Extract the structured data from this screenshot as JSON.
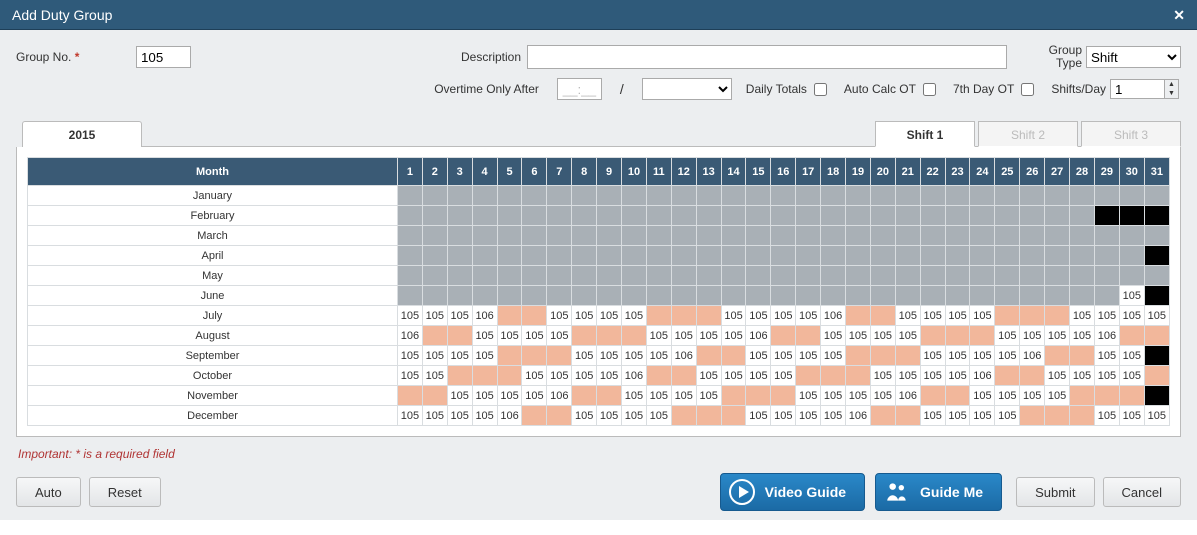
{
  "title": "Add Duty Group",
  "form": {
    "group_no_label": "Group No.",
    "group_no_value": "105",
    "description_label": "Description",
    "description_value": "",
    "group_type_label_line1": "Group",
    "group_type_label_line2": "Type",
    "group_type_value": "Shift",
    "overtime_label": "Overtime Only After",
    "overtime_value1": "__:__",
    "overtime_slash": "/",
    "overtime_value2": "",
    "daily_totals_label": "Daily Totals",
    "auto_calc_label": "Auto Calc OT",
    "seventh_day_label": "7th Day OT",
    "shifts_per_day_label": "Shifts/Day",
    "shifts_per_day_value": "1"
  },
  "tabs": {
    "year": "2015",
    "shift1": "Shift 1",
    "shift2": "Shift 2",
    "shift3": "Shift 3"
  },
  "grid": {
    "month_header": "Month",
    "days": [
      "1",
      "2",
      "3",
      "4",
      "5",
      "6",
      "7",
      "8",
      "9",
      "10",
      "11",
      "12",
      "13",
      "14",
      "15",
      "16",
      "17",
      "18",
      "19",
      "20",
      "21",
      "22",
      "23",
      "24",
      "25",
      "26",
      "27",
      "28",
      "29",
      "30",
      "31"
    ],
    "months": [
      "January",
      "February",
      "March",
      "April",
      "May",
      "June",
      "July",
      "August",
      "September",
      "October",
      "November",
      "December"
    ],
    "cells": {
      "January": [
        "g",
        "g",
        "g",
        "g",
        "g",
        "g",
        "g",
        "g",
        "g",
        "g",
        "g",
        "g",
        "g",
        "g",
        "g",
        "g",
        "g",
        "g",
        "g",
        "g",
        "g",
        "g",
        "g",
        "g",
        "g",
        "g",
        "g",
        "g",
        "g",
        "g",
        "g"
      ],
      "February": [
        "g",
        "g",
        "g",
        "g",
        "g",
        "g",
        "g",
        "g",
        "g",
        "g",
        "g",
        "g",
        "g",
        "g",
        "g",
        "g",
        "g",
        "g",
        "g",
        "g",
        "g",
        "g",
        "g",
        "g",
        "g",
        "g",
        "g",
        "g",
        "b",
        "b",
        "b"
      ],
      "March": [
        "g",
        "g",
        "g",
        "g",
        "g",
        "g",
        "g",
        "g",
        "g",
        "g",
        "g",
        "g",
        "g",
        "g",
        "g",
        "g",
        "g",
        "g",
        "g",
        "g",
        "g",
        "g",
        "g",
        "g",
        "g",
        "g",
        "g",
        "g",
        "g",
        "g",
        "g"
      ],
      "April": [
        "g",
        "g",
        "g",
        "g",
        "g",
        "g",
        "g",
        "g",
        "g",
        "g",
        "g",
        "g",
        "g",
        "g",
        "g",
        "g",
        "g",
        "g",
        "g",
        "g",
        "g",
        "g",
        "g",
        "g",
        "g",
        "g",
        "g",
        "g",
        "g",
        "g",
        "b"
      ],
      "May": [
        "g",
        "g",
        "g",
        "g",
        "g",
        "g",
        "g",
        "g",
        "g",
        "g",
        "g",
        "g",
        "g",
        "g",
        "g",
        "g",
        "g",
        "g",
        "g",
        "g",
        "g",
        "g",
        "g",
        "g",
        "g",
        "g",
        "g",
        "g",
        "g",
        "g",
        "g"
      ],
      "June": [
        "g",
        "g",
        "g",
        "g",
        "g",
        "g",
        "g",
        "g",
        "g",
        "g",
        "g",
        "g",
        "g",
        "g",
        "g",
        "g",
        "g",
        "g",
        "g",
        "g",
        "g",
        "g",
        "g",
        "g",
        "g",
        "g",
        "g",
        "g",
        "g",
        "105",
        "b"
      ],
      "July": [
        "105",
        "105",
        "105",
        "106",
        "p",
        "p",
        "105",
        "105",
        "105",
        "105",
        "p",
        "p",
        "p",
        "105",
        "105",
        "105",
        "105",
        "106",
        "p",
        "p",
        "105",
        "105",
        "105",
        "105",
        "p",
        "p",
        "p",
        "105",
        "105",
        "105",
        "105"
      ],
      "August": [
        "106",
        "p",
        "p",
        "105",
        "105",
        "105",
        "105",
        "p",
        "p",
        "p",
        "105",
        "105",
        "105",
        "105",
        "106",
        "p",
        "p",
        "105",
        "105",
        "105",
        "105",
        "p",
        "p",
        "p",
        "105",
        "105",
        "105",
        "105",
        "106",
        "p",
        "p"
      ],
      "September": [
        "105",
        "105",
        "105",
        "105",
        "p",
        "p",
        "p",
        "105",
        "105",
        "105",
        "105",
        "106",
        "p",
        "p",
        "105",
        "105",
        "105",
        "105",
        "p",
        "p",
        "p",
        "105",
        "105",
        "105",
        "105",
        "106",
        "p",
        "p",
        "105",
        "105",
        "b"
      ],
      "October": [
        "105",
        "105",
        "p",
        "p",
        "p",
        "105",
        "105",
        "105",
        "105",
        "106",
        "p",
        "p",
        "105",
        "105",
        "105",
        "105",
        "p",
        "p",
        "p",
        "105",
        "105",
        "105",
        "105",
        "106",
        "p",
        "p",
        "105",
        "105",
        "105",
        "105",
        "p"
      ],
      "November": [
        "p",
        "p",
        "105",
        "105",
        "105",
        "105",
        "106",
        "p",
        "p",
        "105",
        "105",
        "105",
        "105",
        "p",
        "p",
        "p",
        "105",
        "105",
        "105",
        "105",
        "106",
        "p",
        "p",
        "105",
        "105",
        "105",
        "105",
        "p",
        "p",
        "p",
        "b"
      ],
      "December": [
        "105",
        "105",
        "105",
        "105",
        "106",
        "p",
        "p",
        "105",
        "105",
        "105",
        "105",
        "p",
        "p",
        "p",
        "105",
        "105",
        "105",
        "105",
        "106",
        "p",
        "p",
        "105",
        "105",
        "105",
        "105",
        "p",
        "p",
        "p",
        "105",
        "105",
        "105"
      ]
    }
  },
  "important": "Important: * is a required field",
  "footer": {
    "auto": "Auto",
    "reset": "Reset",
    "video_guide": "Video Guide",
    "guide_me": "Guide Me",
    "submit": "Submit",
    "cancel": "Cancel"
  }
}
